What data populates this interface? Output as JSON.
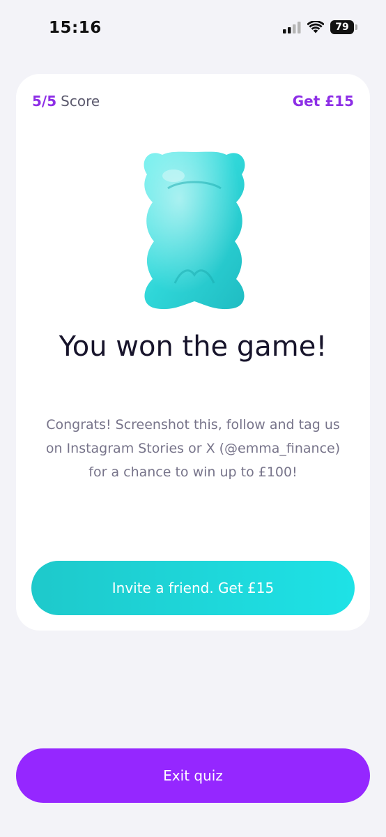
{
  "status_bar": {
    "time": "15:16",
    "battery": "79",
    "icons": [
      "signal-icon",
      "wifi-icon",
      "battery-icon"
    ]
  },
  "quiz": {
    "score_value": "5/5",
    "score_label": "Score",
    "reward_link": "Get £15",
    "image": "gummy-bear-icon",
    "headline": "You won the game!",
    "body": "Congrats! Screenshot this, follow and tag us on Instagram Stories or X (@emma_finance) for a chance to win up to £100!",
    "invite_button": "Invite a friend. Get £15"
  },
  "footer": {
    "exit_button": "Exit quiz"
  },
  "colors": {
    "brand_purple": "#9527ff",
    "accent_teal": "#1ed6da",
    "background": "#f3f3f8",
    "headline": "#17142b"
  }
}
